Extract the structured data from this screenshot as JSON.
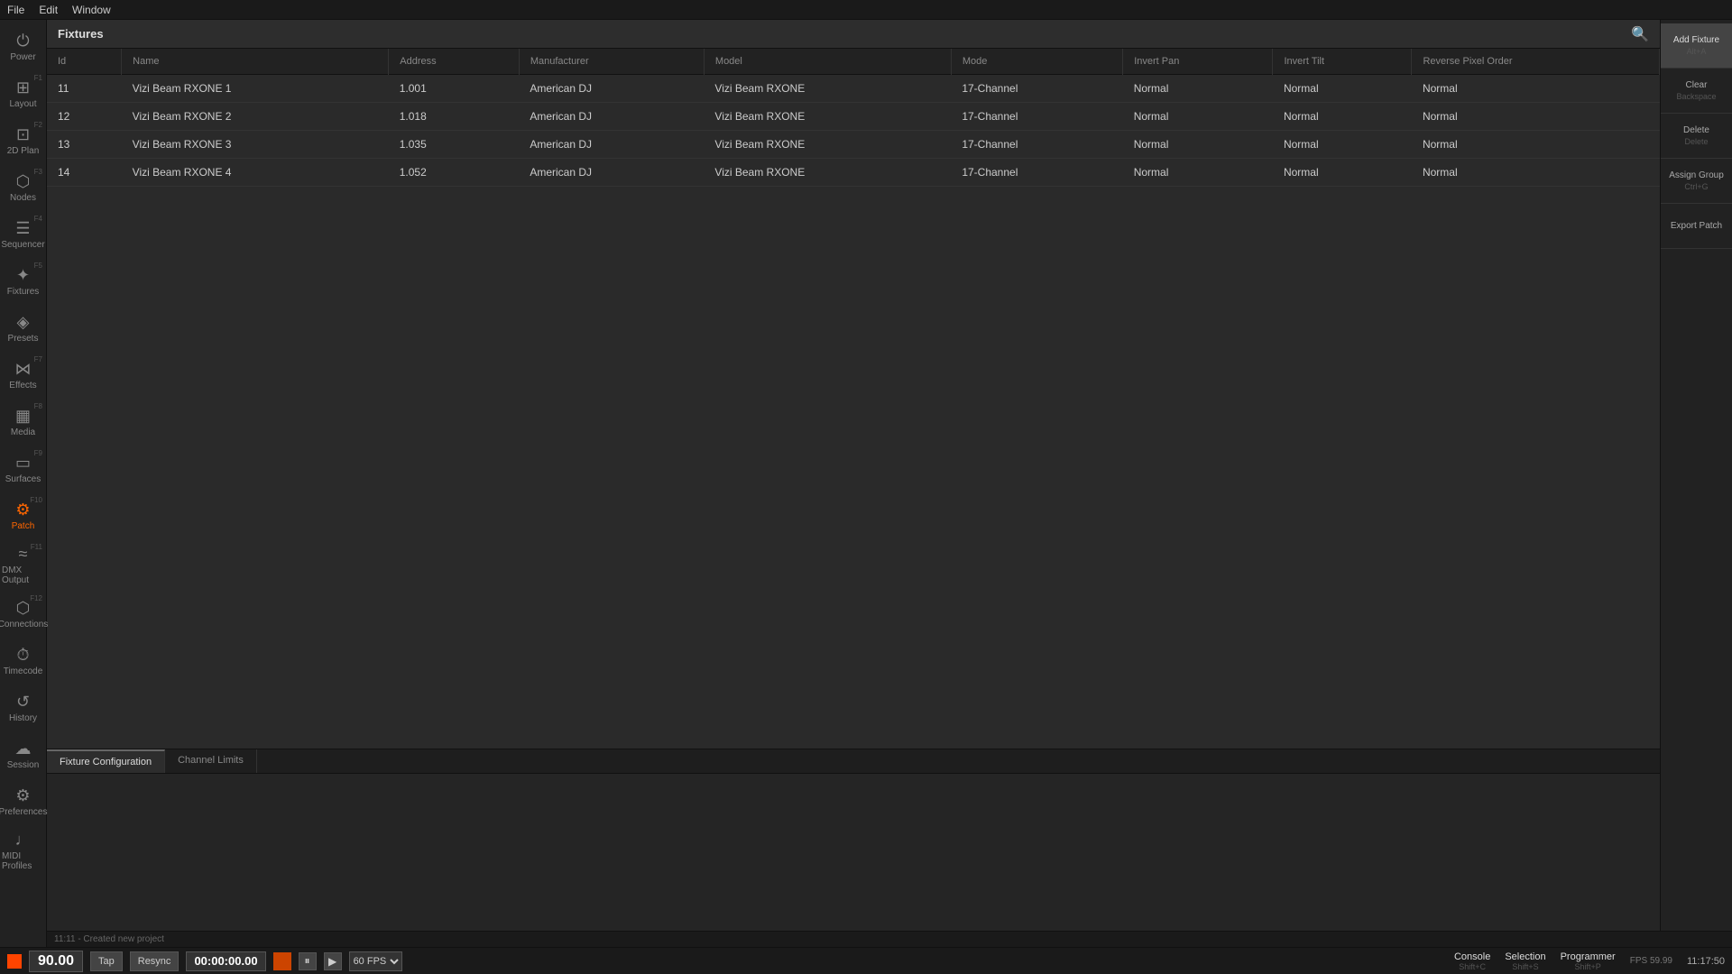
{
  "menubar": {
    "items": [
      "File",
      "Edit",
      "Window"
    ]
  },
  "title": "Fixtures",
  "table": {
    "columns": [
      "Id",
      "Name",
      "Address",
      "Manufacturer",
      "Model",
      "Mode",
      "Invert Pan",
      "Invert Tilt",
      "Reverse Pixel Order"
    ],
    "rows": [
      {
        "id": "11",
        "name": "Vizi Beam RXONE 1",
        "address": "1.001",
        "manufacturer": "American DJ",
        "model": "Vizi Beam RXONE",
        "mode": "17-Channel",
        "invertPan": "Normal",
        "invertTilt": "Normal",
        "reversePixel": "Normal"
      },
      {
        "id": "12",
        "name": "Vizi Beam RXONE 2",
        "address": "1.018",
        "manufacturer": "American DJ",
        "model": "Vizi Beam RXONE",
        "mode": "17-Channel",
        "invertPan": "Normal",
        "invertTilt": "Normal",
        "reversePixel": "Normal"
      },
      {
        "id": "13",
        "name": "Vizi Beam RXONE 3",
        "address": "1.035",
        "manufacturer": "American DJ",
        "model": "Vizi Beam RXONE",
        "mode": "17-Channel",
        "invertPan": "Normal",
        "invertTilt": "Normal",
        "reversePixel": "Normal"
      },
      {
        "id": "14",
        "name": "Vizi Beam RXONE 4",
        "address": "1.052",
        "manufacturer": "American DJ",
        "model": "Vizi Beam RXONE",
        "mode": "17-Channel",
        "invertPan": "Normal",
        "invertTilt": "Normal",
        "reversePixel": "Normal"
      }
    ]
  },
  "sidebar": {
    "items": [
      {
        "label": "Power",
        "icon": "⏻",
        "fkey": ""
      },
      {
        "label": "Layout",
        "icon": "⊞",
        "fkey": "F1"
      },
      {
        "label": "2D Plan",
        "icon": "⊡",
        "fkey": "F2"
      },
      {
        "label": "Nodes",
        "icon": "⬡",
        "fkey": "F3"
      },
      {
        "label": "Sequencer",
        "icon": "≡",
        "fkey": "F4"
      },
      {
        "label": "Fixtures",
        "icon": "✦",
        "fkey": "F5"
      },
      {
        "label": "Presets",
        "icon": "◈",
        "fkey": ""
      },
      {
        "label": "Effects",
        "icon": "⋈",
        "fkey": "F7"
      },
      {
        "label": "Media",
        "icon": "▦",
        "fkey": "F8"
      },
      {
        "label": "Surfaces",
        "icon": "▭",
        "fkey": "F9"
      },
      {
        "label": "Patch",
        "icon": "⚙",
        "fkey": "F10",
        "active": true
      },
      {
        "label": "DMX Output",
        "icon": "≈",
        "fkey": "F11"
      },
      {
        "label": "Connections",
        "icon": "⬡",
        "fkey": "F12"
      },
      {
        "label": "Timecode",
        "icon": "⏱",
        "fkey": ""
      },
      {
        "label": "History",
        "icon": "↺",
        "fkey": ""
      },
      {
        "label": "Session",
        "icon": "☁",
        "fkey": ""
      },
      {
        "label": "Preferences",
        "icon": "⚙",
        "fkey": ""
      },
      {
        "label": "MIDI Profiles",
        "icon": "♩",
        "fkey": ""
      }
    ]
  },
  "right_panel": {
    "buttons": [
      {
        "label": "Add Fixture",
        "shortcut": "Alt+A"
      },
      {
        "label": "Clear",
        "shortcut": "Backspace"
      },
      {
        "label": "Delete",
        "shortcut": "Delete"
      },
      {
        "label": "Assign Group",
        "shortcut": "Ctrl+G"
      },
      {
        "label": "Export Patch",
        "shortcut": ""
      }
    ]
  },
  "bottom_tabs": [
    "Fixture Configuration",
    "Channel Limits"
  ],
  "transport": {
    "bpm": "90.00",
    "tap": "Tap",
    "resync": "Resync",
    "time": "00:00:00.00",
    "fps": "60 FPS",
    "console": "Console",
    "console_shortcut": "Shift+C",
    "selection": "Selection",
    "selection_shortcut": "Shift+S",
    "programmer": "Programmer",
    "programmer_shortcut": "Shift+P",
    "fps_display": "FPS 59.99",
    "clock": "11:17:50"
  },
  "status_bar": {
    "message": "11:11 - Created new project"
  }
}
